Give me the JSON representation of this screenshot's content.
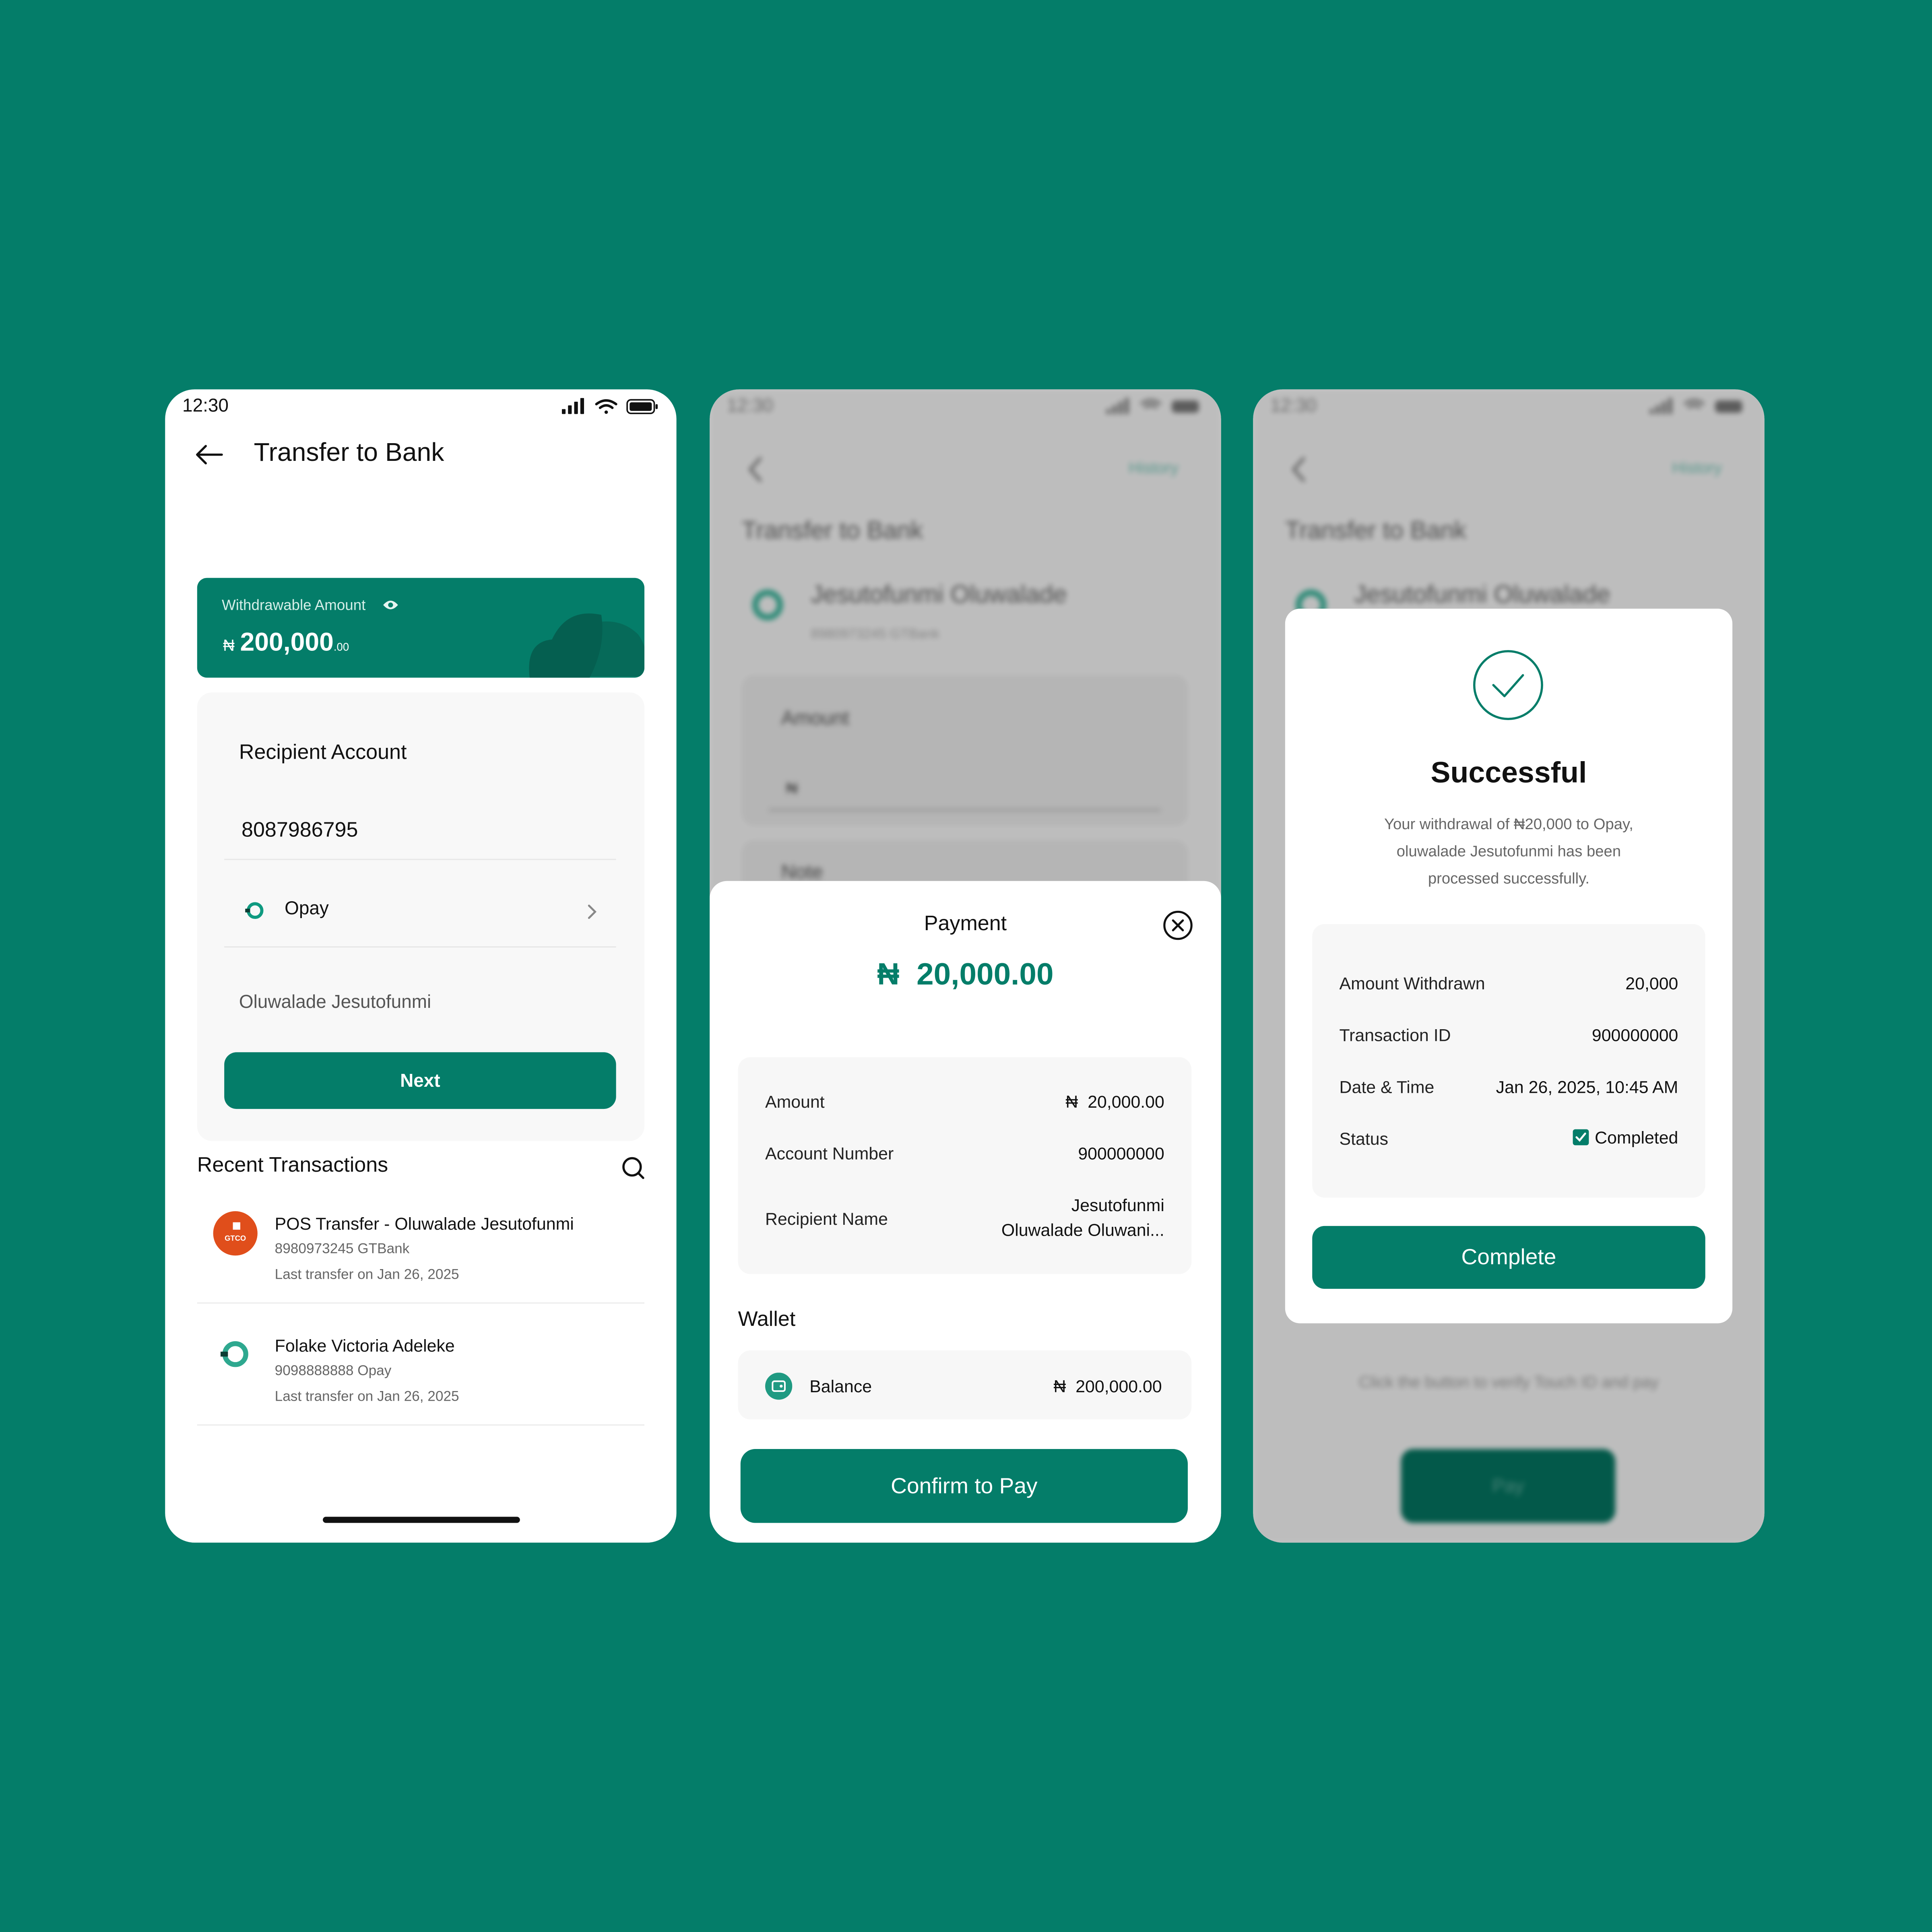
{
  "status_bar": {
    "time": "12:30"
  },
  "screen1": {
    "title": "Transfer to Bank",
    "balance_card": {
      "label": "Withdrawable Amount",
      "currency": "₦",
      "amount": "200,000",
      "decimals": ".00"
    },
    "form": {
      "heading": "Recipient Account",
      "account_number": "8087986795",
      "bank": "Opay",
      "recipient_name": "Oluwalade Jesutofunmi",
      "next_label": "Next"
    },
    "recent": {
      "heading": "Recent Transactions",
      "items": [
        {
          "name": "POS Transfer - Oluwalade Jesutofunmi",
          "account": "8980973245 GTBank",
          "last": "Last transfer on Jan 26, 2025",
          "logo_text": "GTCO"
        },
        {
          "name": "Folake Victoria Adeleke",
          "account": "9098888888 Opay",
          "last": "Last transfer on Jan 26, 2025",
          "logo_text": ""
        }
      ]
    }
  },
  "screen2": {
    "background": {
      "history": "History",
      "title": "Transfer to Bank",
      "recipient": "Jesutofunmi Oluwalade",
      "recipient_sub": "8980973245 GTBank",
      "amount_label": "Amount",
      "amount_prefix": "₦",
      "note_label": "Note"
    },
    "sheet": {
      "title": "Payment",
      "amount": "₦  20,000.00",
      "rows": [
        {
          "label": "Amount",
          "value": "₦  20,000.00"
        },
        {
          "label": "Account Number",
          "value": "900000000"
        },
        {
          "label": "Recipient Name",
          "value_line1": "Jesutofunmi",
          "value_line2": "Oluwalade Oluwani..."
        }
      ],
      "wallet_heading": "Wallet",
      "wallet_label": "Balance",
      "wallet_value": "₦  200,000.00",
      "confirm_label": "Confirm to Pay"
    }
  },
  "screen3": {
    "background": {
      "history": "History",
      "title": "Transfer to Bank",
      "recipient": "Jesutofunmi Oluwalade",
      "hint": "Click the button to verify Touch ID and pay",
      "pay_label": "Pay"
    },
    "modal": {
      "title": "Successful",
      "message_line1": "Your withdrawal of ₦20,000 to Opay,",
      "message_line2": "oluwalade Jesutofunmi has been",
      "message_line3": "processed successfully.",
      "rows": [
        {
          "label": "Amount Withdrawn",
          "value": "20,000"
        },
        {
          "label": "Transaction ID",
          "value": "900000000"
        },
        {
          "label": "Date & Time",
          "value": "Jan 26, 2025, 10:45 AM"
        },
        {
          "label": "Status",
          "value": "Completed"
        }
      ],
      "complete_label": "Complete"
    }
  },
  "colors": {
    "brand": "#047d69",
    "background": "#047d69",
    "card": "#f7f7f7"
  }
}
